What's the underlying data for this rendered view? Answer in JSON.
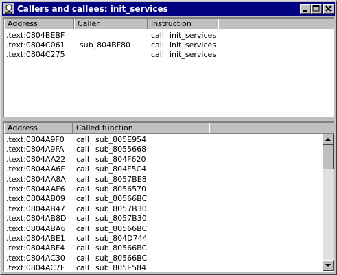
{
  "window": {
    "title": "Callers and callees: init_services"
  },
  "callers": {
    "headers": [
      "Address",
      "Caller",
      "Instruction"
    ],
    "rows": [
      {
        "address": ".text:0804BEBF",
        "caller": "",
        "op": "call",
        "target": "init_services"
      },
      {
        "address": ".text:0804C061",
        "caller": "sub_804BF80",
        "op": "call",
        "target": "init_services"
      },
      {
        "address": ".text:0804C275",
        "caller": "",
        "op": "call",
        "target": "init_services"
      }
    ]
  },
  "callees": {
    "headers": [
      "Address",
      "Called function"
    ],
    "rows": [
      {
        "address": ".text:0804A9F0",
        "op": "call",
        "target": "sub_805E954"
      },
      {
        "address": ".text:0804A9FA",
        "op": "call",
        "target": "sub_8055668"
      },
      {
        "address": ".text:0804AA22",
        "op": "call",
        "target": "sub_804F620"
      },
      {
        "address": ".text:0804AA6F",
        "op": "call",
        "target": "sub_804F5C4"
      },
      {
        "address": ".text:0804AA8A",
        "op": "call",
        "target": "sub_8057BE8"
      },
      {
        "address": ".text:0804AAF6",
        "op": "call",
        "target": "sub_8056570"
      },
      {
        "address": ".text:0804AB09",
        "op": "call",
        "target": "sub_80566BC"
      },
      {
        "address": ".text:0804AB47",
        "op": "call",
        "target": "sub_8057B30"
      },
      {
        "address": ".text:0804AB8D",
        "op": "call",
        "target": "sub_8057B30"
      },
      {
        "address": ".text:0804ABA6",
        "op": "call",
        "target": "sub_80566BC"
      },
      {
        "address": ".text:0804ABE1",
        "op": "call",
        "target": "sub_804D744"
      },
      {
        "address": ".text:0804ABF4",
        "op": "call",
        "target": "sub_80566BC"
      },
      {
        "address": ".text:0804AC30",
        "op": "call",
        "target": "sub_80566BC"
      },
      {
        "address": ".text:0804AC7F",
        "op": "call",
        "target": "sub_805E584"
      }
    ]
  },
  "icons": {
    "title": "app-icon",
    "minimize": "minimize-icon",
    "maximize": "maximize-icon",
    "close": "close-icon",
    "scroll_up": "arrow-up-icon",
    "scroll_down": "arrow-down-icon"
  }
}
